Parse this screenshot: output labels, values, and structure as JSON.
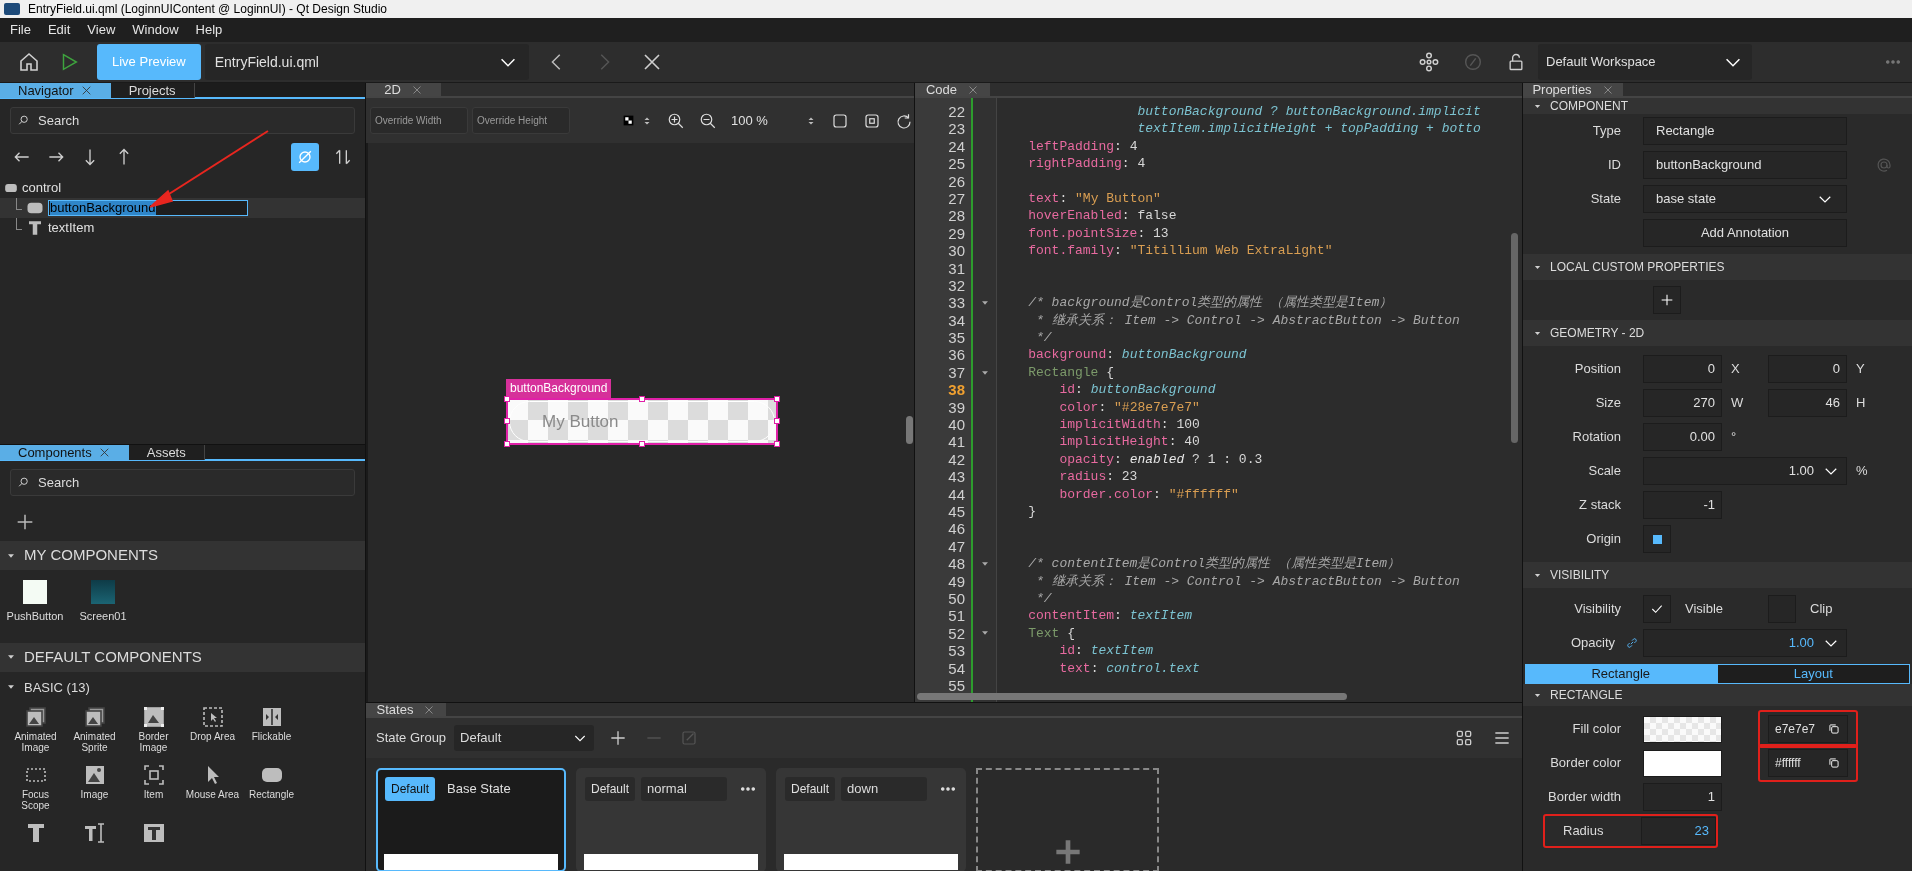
{
  "window": {
    "title": "EntryField.ui.qml (LoginnUIContent @ LoginnUI) - Qt Design Studio"
  },
  "menu": [
    "File",
    "Edit",
    "View",
    "Window",
    "Help"
  ],
  "toolbar": {
    "live_preview": "Live Preview",
    "document": "EntryField.ui.qml",
    "workspace": "Default Workspace"
  },
  "navigator": {
    "tabs": [
      {
        "label": "Navigator",
        "selected": true
      },
      {
        "label": "Projects",
        "selected": false
      }
    ],
    "search": {
      "placeholder": "Search"
    },
    "filter_on": true,
    "tree": [
      {
        "label": "control",
        "kind": "rectangle",
        "selected": false,
        "children": [
          {
            "label": "buttonBackground",
            "kind": "rectangle",
            "selected": true
          },
          {
            "label": "textItem",
            "kind": "text",
            "selected": false
          }
        ]
      }
    ]
  },
  "components": {
    "tabs": [
      {
        "label": "Components",
        "selected": true
      },
      {
        "label": "Assets",
        "selected": false
      }
    ],
    "search": {
      "placeholder": "Search"
    },
    "my_components": {
      "title": "MY COMPONENTS",
      "items": [
        {
          "label": "PushButton",
          "kind": "light"
        },
        {
          "label": "Screen01",
          "kind": "dark"
        }
      ]
    },
    "default_components": {
      "title": "DEFAULT COMPONENTS",
      "group": "BASIC (13)",
      "items": [
        {
          "label": "Animated Image",
          "kind": "animated-image"
        },
        {
          "label": "Animated Sprite",
          "kind": "animated-image"
        },
        {
          "label": "Border Image",
          "kind": "border-image"
        },
        {
          "label": "Drop Area",
          "kind": "drop-area"
        },
        {
          "label": "Flickable",
          "kind": "flickable"
        },
        {
          "label": "Focus Scope",
          "kind": "focus-scope"
        },
        {
          "label": "Image",
          "kind": "image"
        },
        {
          "label": "Item",
          "kind": "item"
        },
        {
          "label": "Mouse Area",
          "kind": "mouse-area"
        },
        {
          "label": "Rectangle",
          "kind": "rectangle"
        },
        {
          "kind": "text"
        },
        {
          "kind": "text-edit"
        },
        {
          "kind": "text-input"
        }
      ]
    }
  },
  "editor_2d": {
    "tab": "2D",
    "override_width": {
      "placeholder": "Override Width"
    },
    "override_height": {
      "placeholder": "Override Height"
    },
    "zoom": "100 %",
    "selection_label": "buttonBackground",
    "button_text": "My Button"
  },
  "code": {
    "tab": "Code",
    "lines": [
      {
        "number": "22",
        "current": false,
        "foldable": false,
        "segments": [
          {
            "kind": "ident",
            "text": "                  buttonBackground ? buttonBackground.implicit"
          }
        ]
      },
      {
        "number": "23",
        "current": false,
        "foldable": false,
        "segments": [
          {
            "kind": "ident",
            "text": "                  textItem.implicitHeight + topPadding + botto"
          }
        ]
      },
      {
        "number": "24",
        "current": false,
        "foldable": false,
        "segments": [
          {
            "kind": "prop",
            "text": "    leftPadding"
          },
          {
            "kind": "plain",
            "text": ": 4"
          }
        ]
      },
      {
        "number": "25",
        "current": false,
        "foldable": false,
        "segments": [
          {
            "kind": "prop",
            "text": "    rightPadding"
          },
          {
            "kind": "plain",
            "text": ": 4"
          }
        ]
      },
      {
        "number": "26",
        "current": false,
        "foldable": false
      },
      {
        "number": "27",
        "current": false,
        "foldable": false,
        "segments": [
          {
            "kind": "prop",
            "text": "    text"
          },
          {
            "kind": "plain",
            "text": ": "
          },
          {
            "kind": "str",
            "text": "\"My Button\""
          }
        ]
      },
      {
        "number": "28",
        "current": false,
        "foldable": false,
        "segments": [
          {
            "kind": "prop",
            "text": "    hoverEnabled"
          },
          {
            "kind": "plain",
            "text": ": false"
          }
        ]
      },
      {
        "number": "29",
        "current": false,
        "foldable": false,
        "segments": [
          {
            "kind": "prop",
            "text": "    font.pointSize"
          },
          {
            "kind": "plain",
            "text": ": 13"
          }
        ]
      },
      {
        "number": "30",
        "current": false,
        "foldable": false,
        "segments": [
          {
            "kind": "prop",
            "text": "    font.family"
          },
          {
            "kind": "plain",
            "text": ": "
          },
          {
            "kind": "str",
            "text": "\"Titillium Web ExtraLight\""
          }
        ]
      },
      {
        "number": "31",
        "current": false,
        "foldable": false
      },
      {
        "number": "32",
        "current": false,
        "foldable": false
      },
      {
        "number": "33",
        "current": false,
        "foldable": true,
        "segments": [
          {
            "kind": "comment",
            "text": "    /* background是Control类型的属性 （属性类型是Item）"
          }
        ]
      },
      {
        "number": "34",
        "current": false,
        "foldable": false,
        "segments": [
          {
            "kind": "comment",
            "text": "     * 继承关系： Item -> Control -> AbstractButton -> Button"
          }
        ]
      },
      {
        "number": "35",
        "current": false,
        "foldable": false,
        "segments": [
          {
            "kind": "comment",
            "text": "     */"
          }
        ]
      },
      {
        "number": "36",
        "current": false,
        "foldable": false,
        "segments": [
          {
            "kind": "prop",
            "text": "    background"
          },
          {
            "kind": "plain",
            "text": ": "
          },
          {
            "kind": "ident",
            "text": "buttonBackground"
          }
        ]
      },
      {
        "number": "37",
        "current": false,
        "foldable": true,
        "segments": [
          {
            "kind": "type",
            "text": "    Rectangle"
          },
          {
            "kind": "plain",
            "text": " {"
          }
        ]
      },
      {
        "number": "38",
        "current": true,
        "foldable": false,
        "segments": [
          {
            "kind": "prop",
            "text": "        id"
          },
          {
            "kind": "plain",
            "text": ": "
          },
          {
            "kind": "ident",
            "text": "buttonBackground"
          }
        ]
      },
      {
        "number": "39",
        "current": false,
        "foldable": false,
        "segments": [
          {
            "kind": "prop",
            "text": "        color"
          },
          {
            "kind": "plain",
            "text": ": "
          },
          {
            "kind": "str",
            "text": "\"#28e7e7e7\""
          }
        ]
      },
      {
        "number": "40",
        "current": false,
        "foldable": false,
        "segments": [
          {
            "kind": "prop",
            "text": "        implicitWidth"
          },
          {
            "kind": "plain",
            "text": ": 100"
          }
        ]
      },
      {
        "number": "41",
        "current": false,
        "foldable": false,
        "segments": [
          {
            "kind": "prop",
            "text": "        implicitHeight"
          },
          {
            "kind": "plain",
            "text": ": 40"
          }
        ]
      },
      {
        "number": "42",
        "current": false,
        "foldable": false,
        "segments": [
          {
            "kind": "prop",
            "text": "        opacity"
          },
          {
            "kind": "plain",
            "text": ": "
          },
          {
            "kind": "italic",
            "text": "enabled"
          },
          {
            "kind": "plain",
            "text": " ? 1 : 0.3"
          }
        ]
      },
      {
        "number": "43",
        "current": false,
        "foldable": false,
        "segments": [
          {
            "kind": "prop",
            "text": "        radius"
          },
          {
            "kind": "plain",
            "text": ": 23"
          }
        ]
      },
      {
        "number": "44",
        "current": false,
        "foldable": false,
        "segments": [
          {
            "kind": "prop",
            "text": "        border.color"
          },
          {
            "kind": "plain",
            "text": ": "
          },
          {
            "kind": "str",
            "text": "\"#ffffff\""
          }
        ]
      },
      {
        "number": "45",
        "current": false,
        "foldable": false,
        "segments": [
          {
            "kind": "plain",
            "text": "    }"
          }
        ]
      },
      {
        "number": "46",
        "current": false,
        "foldable": false
      },
      {
        "number": "47",
        "current": false,
        "foldable": false
      },
      {
        "number": "48",
        "current": false,
        "foldable": true,
        "segments": [
          {
            "kind": "comment",
            "text": "    /* contentItem是Control类型的属性 （属性类型是Item）"
          }
        ]
      },
      {
        "number": "49",
        "current": false,
        "foldable": false,
        "segments": [
          {
            "kind": "comment",
            "text": "     * 继承关系： Item -> Control -> AbstractButton -> Button"
          }
        ]
      },
      {
        "number": "50",
        "current": false,
        "foldable": false,
        "segments": [
          {
            "kind": "comment",
            "text": "     */"
          }
        ]
      },
      {
        "number": "51",
        "current": false,
        "foldable": false,
        "segments": [
          {
            "kind": "prop",
            "text": "    contentItem"
          },
          {
            "kind": "plain",
            "text": ": "
          },
          {
            "kind": "ident",
            "text": "textItem"
          }
        ]
      },
      {
        "number": "52",
        "current": false,
        "foldable": true,
        "segments": [
          {
            "kind": "type",
            "text": "    Text"
          },
          {
            "kind": "plain",
            "text": " {"
          }
        ]
      },
      {
        "number": "53",
        "current": false,
        "foldable": false,
        "segments": [
          {
            "kind": "prop",
            "text": "        id"
          },
          {
            "kind": "plain",
            "text": ": "
          },
          {
            "kind": "ident",
            "text": "textItem"
          }
        ]
      },
      {
        "number": "54",
        "current": false,
        "foldable": false,
        "segments": [
          {
            "kind": "prop",
            "text": "        text"
          },
          {
            "kind": "plain",
            "text": ": "
          },
          {
            "kind": "ident",
            "text": "control.text"
          }
        ]
      },
      {
        "number": "55",
        "current": false,
        "foldable": false
      }
    ]
  },
  "states": {
    "tab": "States",
    "group_label": "State Group",
    "group": "Default",
    "cards": [
      {
        "badge": "Default",
        "name": "Base State",
        "kind": "base",
        "selected": true
      },
      {
        "badge": "Default",
        "name": "normal",
        "kind": "state",
        "selected": false
      },
      {
        "badge": "Default",
        "name": "down",
        "kind": "state",
        "selected": false
      }
    ]
  },
  "properties": {
    "tab": "Properties",
    "component": {
      "title": "COMPONENT",
      "rows": [
        {
          "label": "Type",
          "kind": "field",
          "value": "Rectangle"
        },
        {
          "label": "ID",
          "kind": "id",
          "value": "buttonBackground"
        },
        {
          "label": "State",
          "kind": "dropdown",
          "value": "base state"
        }
      ],
      "annotation_button": "Add Annotation"
    },
    "local": {
      "title": "LOCAL CUSTOM PROPERTIES"
    },
    "geometry": {
      "title": "GEOMETRY - 2D",
      "rows": [
        {
          "label": "Position",
          "kind": "pair",
          "fields": [
            {
              "value": "0",
              "unit": "X"
            },
            {
              "value": "0",
              "unit": "Y"
            }
          ]
        },
        {
          "label": "Size",
          "kind": "pair",
          "fields": [
            {
              "value": "270",
              "unit": "W"
            },
            {
              "value": "46",
              "unit": "H"
            }
          ]
        },
        {
          "label": "Rotation",
          "kind": "single",
          "value": "0.00",
          "unit": "°"
        },
        {
          "label": "Scale",
          "kind": "dropdown",
          "value": "1.00",
          "unit": "%"
        },
        {
          "label": "Z stack",
          "kind": "single",
          "value": "-1"
        },
        {
          "label": "Origin",
          "kind": "origin"
        }
      ]
    },
    "visibility": {
      "title": "VISIBILITY",
      "label": "Visibility",
      "visible": {
        "text": "Visible",
        "checked": true
      },
      "clip": {
        "text": "Clip",
        "checked": false
      },
      "opacity": {
        "label": "Opacity",
        "value": "1.00"
      }
    },
    "tabs": [
      {
        "label": "Rectangle",
        "selected": true
      },
      {
        "label": "Layout",
        "selected": false
      }
    ],
    "rectangle": {
      "title": "RECTANGLE",
      "rows": [
        {
          "label": "Fill color",
          "kind": "color",
          "transparent": true,
          "value": "e7e7e7",
          "highlighted": true
        },
        {
          "label": "Border color",
          "kind": "color",
          "transparent": false,
          "value": "#ffffff",
          "highlighted": true
        },
        {
          "label": "Border width",
          "kind": "number",
          "value": "1",
          "bound": false,
          "highlighted": false
        },
        {
          "label": "Radius",
          "kind": "number",
          "value": "23",
          "bound": true,
          "highlighted": true
        }
      ]
    }
  }
}
